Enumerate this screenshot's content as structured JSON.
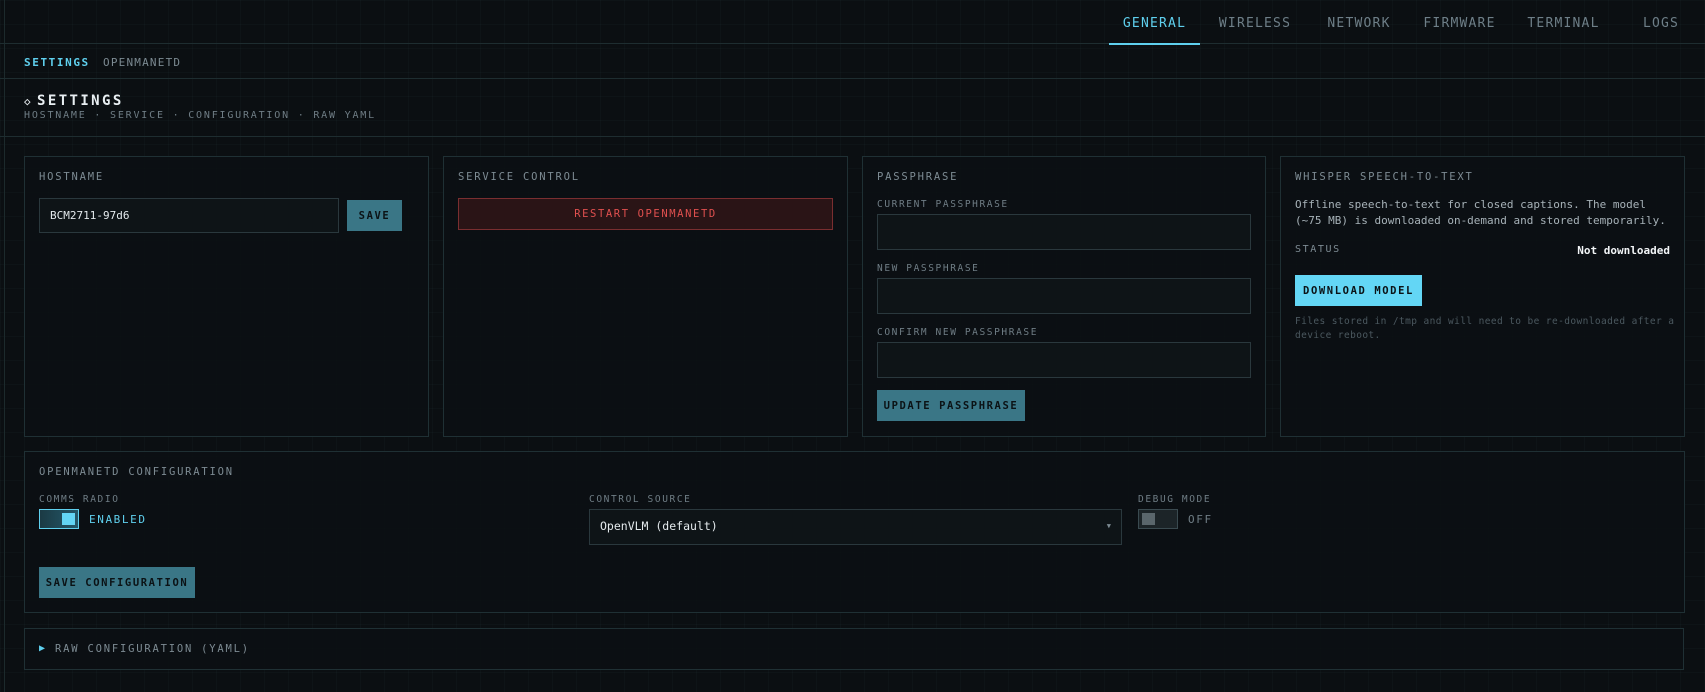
{
  "nav": {
    "tabs": [
      {
        "label": "GENERAL",
        "active": true
      },
      {
        "label": "WIRELESS",
        "active": false
      },
      {
        "label": "NETWORK",
        "active": false
      },
      {
        "label": "FIRMWARE",
        "active": false
      },
      {
        "label": "TERMINAL",
        "active": false
      },
      {
        "label": "LOGS",
        "active": false
      }
    ]
  },
  "breadcrumb": {
    "section": "SETTINGS",
    "app": "OPENMANETD"
  },
  "header": {
    "title": "SETTINGS",
    "subtitle": "HOSTNAME · SERVICE · CONFIGURATION · RAW YAML"
  },
  "hostname_card": {
    "title": "HOSTNAME",
    "value": "BCM2711-97d6",
    "save_label": "SAVE"
  },
  "service_card": {
    "title": "SERVICE CONTROL",
    "restart_label": "RESTART OPENMANETD"
  },
  "passphrase_card": {
    "title": "PASSPHRASE",
    "current_label": "CURRENT PASSPHRASE",
    "new_label": "NEW PASSPHRASE",
    "confirm_label": "CONFIRM NEW PASSPHRASE",
    "update_label": "UPDATE PASSPHRASE"
  },
  "whisper_card": {
    "title": "WHISPER SPEECH-TO-TEXT",
    "description": "Offline speech-to-text for closed captions. The model (~75 MB) is downloaded on-demand and stored temporarily.",
    "status_label": "STATUS",
    "status_value": "Not downloaded",
    "download_label": "DOWNLOAD MODEL",
    "note": "Files stored in /tmp and will need to be re-downloaded after a device reboot."
  },
  "config_card": {
    "title": "OPENMANETD CONFIGURATION",
    "comms_radio": {
      "label": "COMMS RADIO",
      "state": "ENABLED",
      "on": true
    },
    "control_source": {
      "label": "CONTROL SOURCE",
      "selected": "OpenVLM (default)"
    },
    "debug_mode": {
      "label": "DEBUG MODE",
      "state": "OFF",
      "on": false
    },
    "save_label": "SAVE CONFIGURATION"
  },
  "raw_config": {
    "label": "RAW CONFIGURATION (YAML)"
  },
  "colors": {
    "accent": "#5fd0ee",
    "button_teal": "#3a7686",
    "danger": "#e0504f",
    "background": "#0b0f12"
  },
  "icons": {
    "title_marker": "diamond-icon",
    "raw_expander": "triangle-right-icon",
    "select_caret": "caret-down-icon"
  }
}
